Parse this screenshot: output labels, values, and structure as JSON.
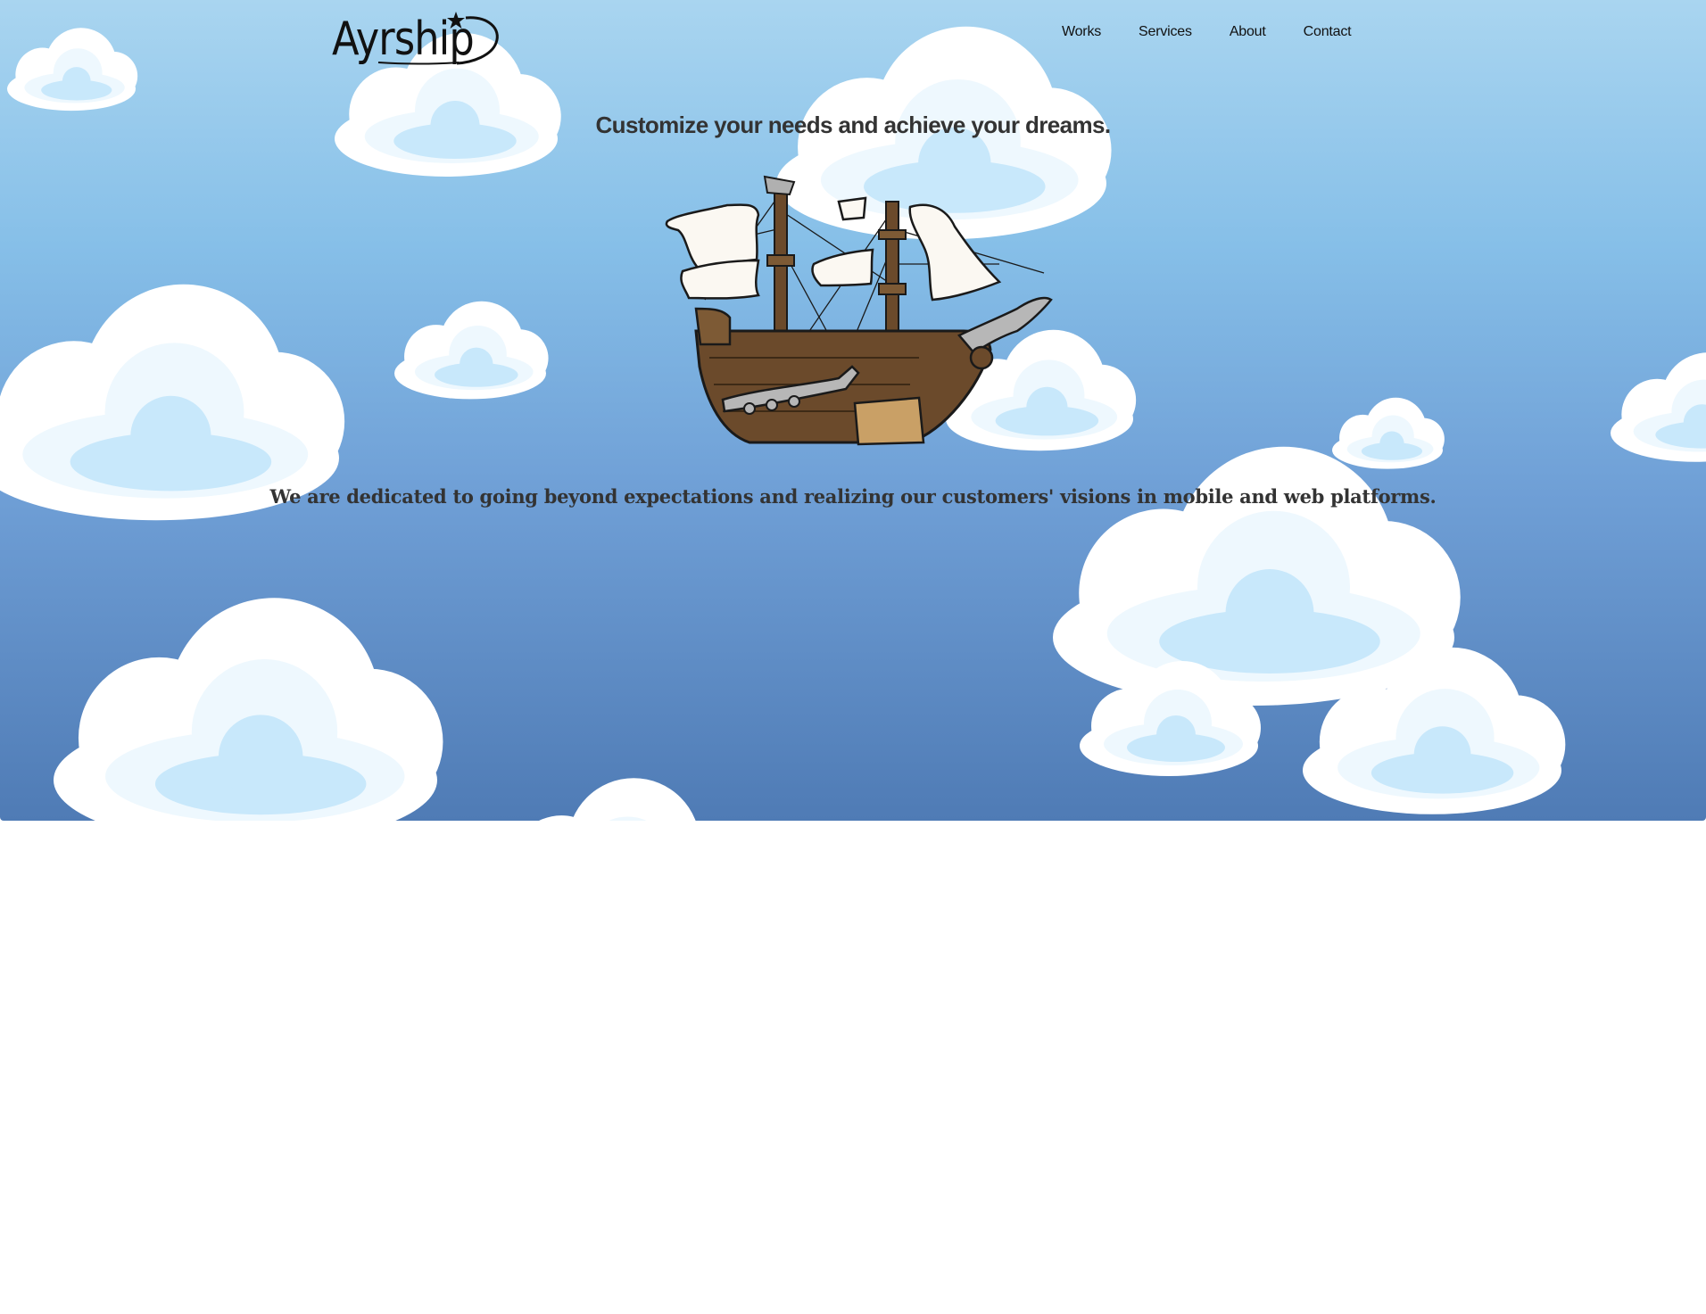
{
  "brand": {
    "logo_text": "Ayrship"
  },
  "nav": {
    "items": [
      {
        "label": "Works"
      },
      {
        "label": "Services"
      },
      {
        "label": "About"
      },
      {
        "label": "Contact"
      }
    ]
  },
  "hero": {
    "tagline": "Customize your needs and achieve your dreams.",
    "mission": "We are dedicated to going beyond expectations and realizing our customers' visions in mobile and web platforms."
  },
  "colors": {
    "sky_top": "#a9d5f0",
    "sky_bottom": "#4f7bb5",
    "cloud_white": "#ffffff",
    "cloud_light": "#e3f3fd",
    "cloud_blue": "#c5e6fa",
    "text_dark": "#333333"
  },
  "icons": {
    "logo_star": "star-icon",
    "ship": "airship-illustration"
  }
}
